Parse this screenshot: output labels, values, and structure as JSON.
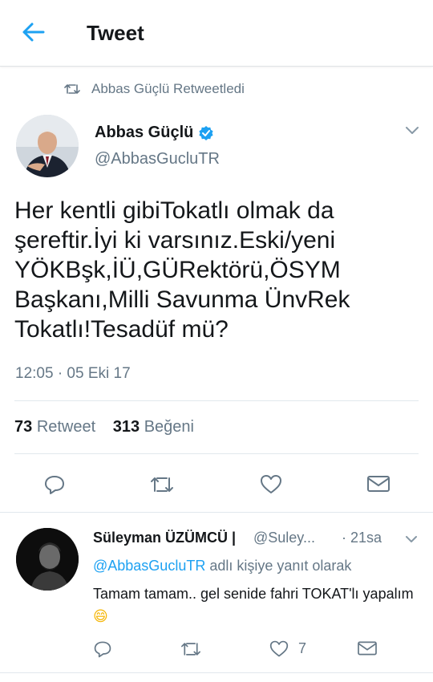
{
  "header": {
    "title": "Tweet",
    "back_icon": "arrow-left-icon",
    "accent": "#1da1f2"
  },
  "retweet_note": {
    "icon": "retweet-icon",
    "text": "Abbas Güçlü Retweetledi"
  },
  "tweet": {
    "author_name": "Abbas Güçlü",
    "verified": true,
    "handle": "@AbbasGucluTR",
    "text": "Her kentli gibiTokatlı olmak da şereftir.İyi ki varsınız.Eski/yeni YÖKBşk,İÜ,GÜRektörü,ÖSYM Başkanı,Milli Savunma ÜnvRek Tokatlı!Tesadüf mü?",
    "timestamp": "12:05 · 05 Eki 17",
    "retweet_count": "73",
    "retweet_label": "Retweet",
    "like_count": "313",
    "like_label": "Beğeni"
  },
  "reply": {
    "author_name": "Süleyman ÜZÜMCÜ |",
    "handle": "@Suley...",
    "time": "· 21sa",
    "mention": "@AbbasGucluTR",
    "reply_suffix": " adlı kişiye yanıt olarak",
    "text": "Tamam tamam.. gel senide fahri TOKAT'lı yapalım",
    "emoji": "😄",
    "like_count": "7"
  },
  "colors": {
    "muted": "#657786",
    "text": "#14171a",
    "border": "#e1e8ed"
  }
}
